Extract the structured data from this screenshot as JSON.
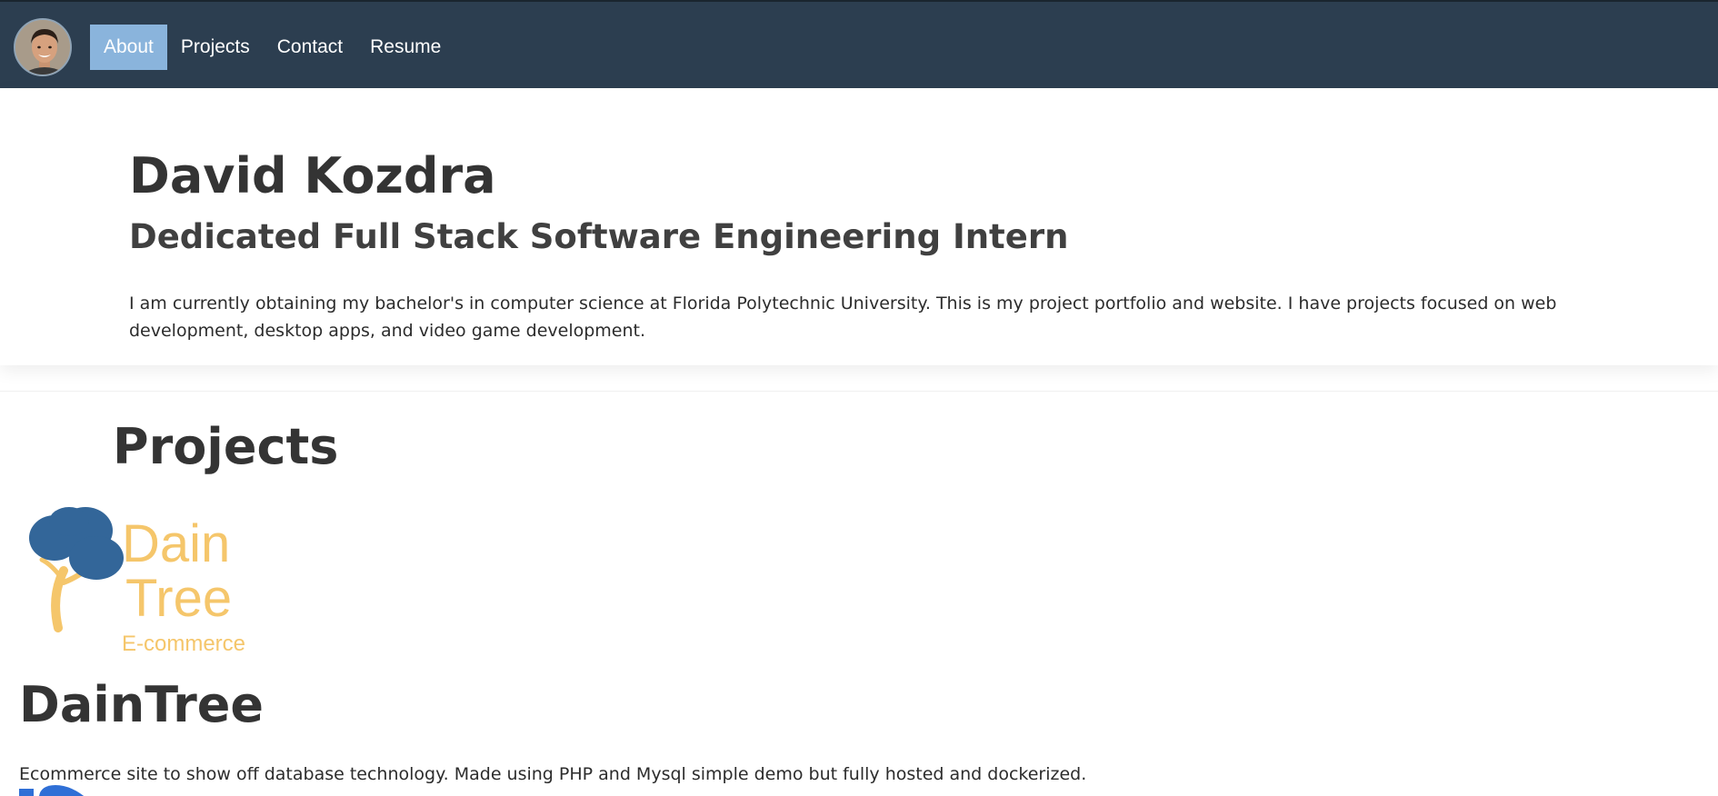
{
  "nav": {
    "items": [
      {
        "label": "About",
        "active": true
      },
      {
        "label": "Projects",
        "active": false
      },
      {
        "label": "Contact",
        "active": false
      },
      {
        "label": "Resume",
        "active": false
      }
    ]
  },
  "hero": {
    "name": "David Kozdra",
    "subtitle": "Dedicated Full Stack Software Engineering Intern",
    "bio": "I am currently obtaining my bachelor's in computer science at Florida Polytechnic University. This is my project portfolio and website. I have projects focused on web development, desktop apps, and video game development."
  },
  "projects": {
    "heading": "Projects",
    "items": [
      {
        "logo": {
          "line1": "Dain",
          "line2": "Tree",
          "line3": "E-commerce"
        },
        "title": "DainTree",
        "description": "Ecommerce site to show off database technology. Made using PHP and Mysql simple demo but fully hosted and dockerized."
      }
    ]
  },
  "colors": {
    "navbar": "#2c3e50",
    "active_tab": "#8ab4dc",
    "logo_tree_blue": "#336699",
    "logo_gold": "#f5c66b",
    "next_logo_blue": "#2f6fd6"
  }
}
